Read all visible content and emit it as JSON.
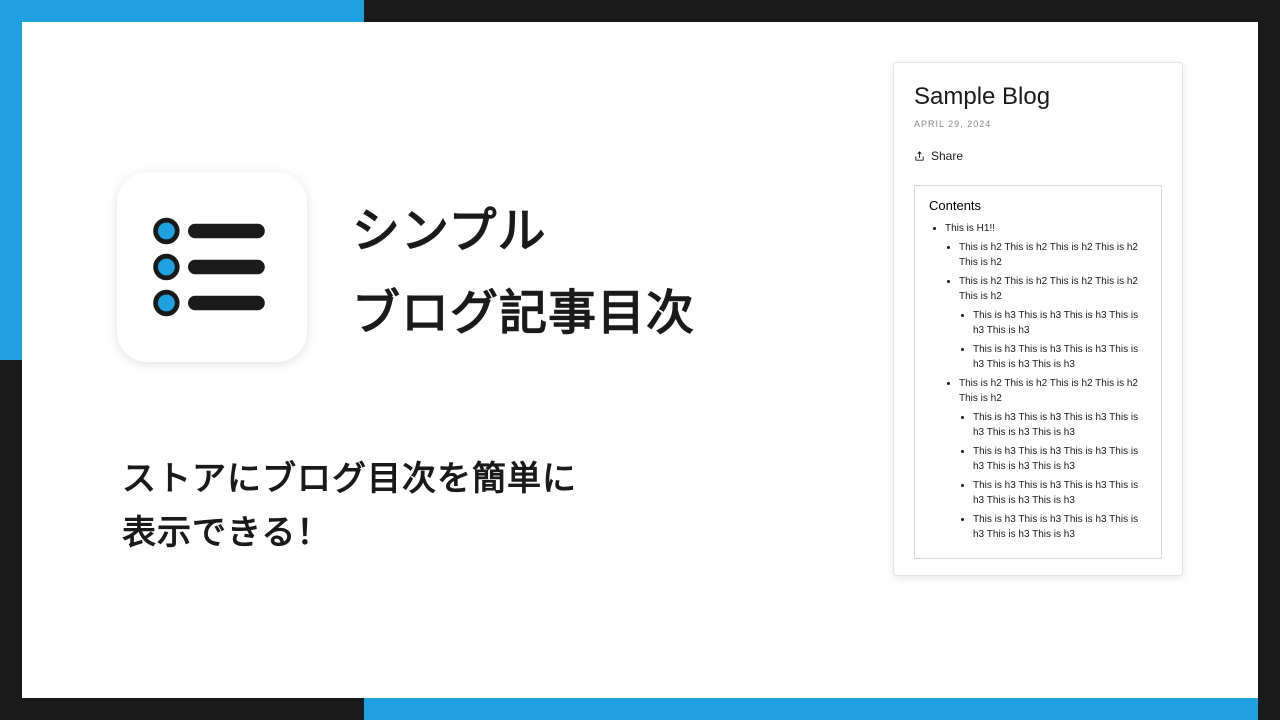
{
  "hero": {
    "title_line1": "シンプル",
    "title_line2": "ブログ記事目次",
    "subtitle_line1": "ストアにブログ目次を簡単に",
    "subtitle_line2": "表示できる！"
  },
  "card": {
    "title": "Sample Blog",
    "date": "APRIL 29, 2024",
    "share_label": "Share",
    "toc_heading": "Contents",
    "toc": {
      "h1": "This is H1!!",
      "h2a": "This is h2 This is h2 This is h2 This is h2 This is h2",
      "h2b": "This is h2 This is h2 This is h2 This is h2 This is h2",
      "h2b_h3a": "This is h3 This is h3 This is h3 This is h3 This is h3",
      "h2b_h3b": "This is h3 This is h3 This is h3 This is h3 This is h3 This is h3",
      "h2c": "This is h2 This is h2 This is h2 This is h2 This is h2",
      "h2c_h3a": "This is h3 This is h3 This is h3 This is h3 This is h3 This is h3",
      "h2c_h3b": "This is h3 This is h3 This is h3 This is h3 This is h3 This is h3",
      "h2c_h3c": "This is h3 This is h3 This is h3 This is h3 This is h3 This is h3",
      "h2c_h3d": "This is h3 This is h3 This is h3 This is h3 This is h3 This is h3"
    }
  },
  "colors": {
    "accent_blue": "#1fa0e0",
    "accent_dark": "#1a1a1a"
  }
}
